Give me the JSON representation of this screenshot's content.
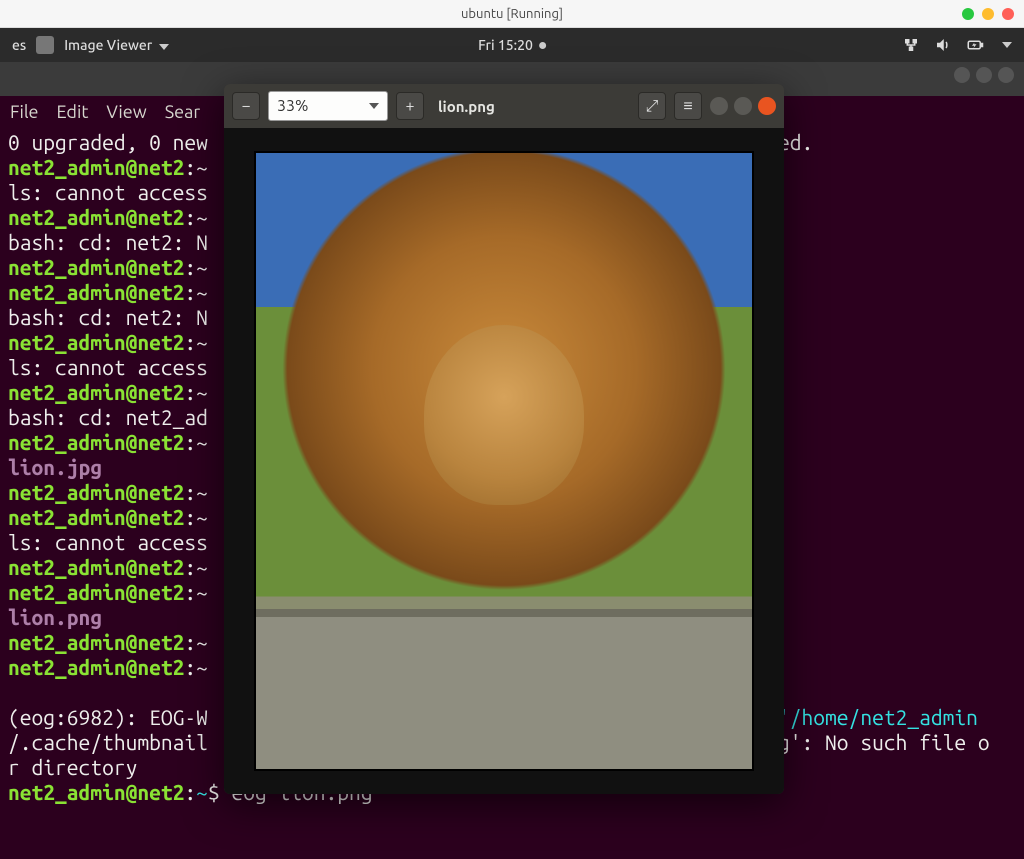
{
  "host": {
    "title": "ubuntu [Running]"
  },
  "gnome": {
    "app_label": "Image Viewer",
    "clock": "Fri 15:20",
    "left_cut": "es",
    "icons": {
      "network": "network-wired-icon",
      "volume": "volume-icon",
      "battery": "battery-icon",
      "arrow": "dropdown-arrow-icon"
    }
  },
  "terminal": {
    "menu": {
      "file": "File",
      "edit": "Edit",
      "view": "View",
      "search_cut": "Sear"
    },
    "lines": [
      {
        "segments": [
          {
            "cls": "fg-white",
            "text": "0 upgraded, 0 new"
          }
        ],
        "tail": {
          "cls": "fg-white",
          "text": "ed."
        }
      },
      {
        "segments": [
          {
            "cls": "fg-green",
            "text": "net2_admin@net2"
          },
          {
            "cls": "fg-white",
            "text": ":~"
          }
        ]
      },
      {
        "segments": [
          {
            "cls": "fg-white",
            "text": "ls: cannot access"
          }
        ]
      },
      {
        "segments": [
          {
            "cls": "fg-green",
            "text": "net2_admin@net2"
          },
          {
            "cls": "fg-white",
            "text": ":~"
          }
        ]
      },
      {
        "segments": [
          {
            "cls": "fg-white",
            "text": "bash: cd: net2: N"
          }
        ]
      },
      {
        "segments": [
          {
            "cls": "fg-green",
            "text": "net2_admin@net2"
          },
          {
            "cls": "fg-white",
            "text": ":~"
          }
        ]
      },
      {
        "segments": [
          {
            "cls": "fg-green",
            "text": "net2_admin@net2"
          },
          {
            "cls": "fg-white",
            "text": ":~"
          }
        ]
      },
      {
        "segments": [
          {
            "cls": "fg-white",
            "text": "bash: cd: net2: N"
          }
        ]
      },
      {
        "segments": [
          {
            "cls": "fg-green",
            "text": "net2_admin@net2"
          },
          {
            "cls": "fg-white",
            "text": ":~"
          }
        ]
      },
      {
        "segments": [
          {
            "cls": "fg-white",
            "text": "ls: cannot access"
          }
        ]
      },
      {
        "segments": [
          {
            "cls": "fg-green",
            "text": "net2_admin@net2"
          },
          {
            "cls": "fg-white",
            "text": ":~"
          }
        ]
      },
      {
        "segments": [
          {
            "cls": "fg-white",
            "text": "bash: cd: net2_ad"
          }
        ]
      },
      {
        "segments": [
          {
            "cls": "fg-green",
            "text": "net2_admin@net2"
          },
          {
            "cls": "fg-white",
            "text": ":~"
          }
        ]
      },
      {
        "segments": [
          {
            "cls": "fg-purple",
            "text": "lion.jpg"
          }
        ]
      },
      {
        "segments": [
          {
            "cls": "fg-green",
            "text": "net2_admin@net2"
          },
          {
            "cls": "fg-white",
            "text": ":~"
          }
        ]
      },
      {
        "segments": [
          {
            "cls": "fg-green",
            "text": "net2_admin@net2"
          },
          {
            "cls": "fg-white",
            "text": ":~"
          }
        ]
      },
      {
        "segments": [
          {
            "cls": "fg-white",
            "text": "ls: cannot access"
          }
        ]
      },
      {
        "segments": [
          {
            "cls": "fg-green",
            "text": "net2_admin@net2"
          },
          {
            "cls": "fg-white",
            "text": ":~"
          }
        ]
      },
      {
        "segments": [
          {
            "cls": "fg-green",
            "text": "net2_admin@net2"
          },
          {
            "cls": "fg-white",
            "text": ":~"
          }
        ]
      },
      {
        "segments": [
          {
            "cls": "fg-purple",
            "text": "lion.png"
          }
        ]
      },
      {
        "segments": [
          {
            "cls": "fg-green",
            "text": "net2_admin@net2"
          },
          {
            "cls": "fg-white",
            "text": ":~"
          }
        ]
      },
      {
        "segments": [
          {
            "cls": "fg-green",
            "text": "net2_admin@net2"
          },
          {
            "cls": "fg-white",
            "text": ":~"
          }
        ]
      },
      {
        "segments": [
          {
            "cls": "fg-white",
            "text": ""
          }
        ]
      },
      {
        "segments": [
          {
            "cls": "fg-white",
            "text": "(eog:6982): EOG-W"
          }
        ],
        "tail": {
          "cls": "fg-teal",
          "text": "'/home/net2_admin"
        }
      },
      {
        "segments": [
          {
            "cls": "fg-white",
            "text": "/.cache/thumbnail"
          }
        ],
        "tail": {
          "cls": "fg-white",
          "text": "g': No such file o"
        }
      },
      {
        "segments": [
          {
            "cls": "fg-white",
            "text": "r directory"
          }
        ]
      },
      {
        "segments": [
          {
            "cls": "fg-green",
            "text": "net2_admin@net2"
          },
          {
            "cls": "fg-white",
            "text": ":"
          },
          {
            "cls": "fg-teal",
            "text": "~"
          },
          {
            "cls": "fg-white",
            "text": "$ eog lion.png"
          }
        ]
      }
    ]
  },
  "eog": {
    "zoom": "33%",
    "filename": "lion.png",
    "btn": {
      "zoom_out": "−",
      "zoom_in": "+",
      "fullscreen": "⤢",
      "menu": "≡"
    }
  }
}
